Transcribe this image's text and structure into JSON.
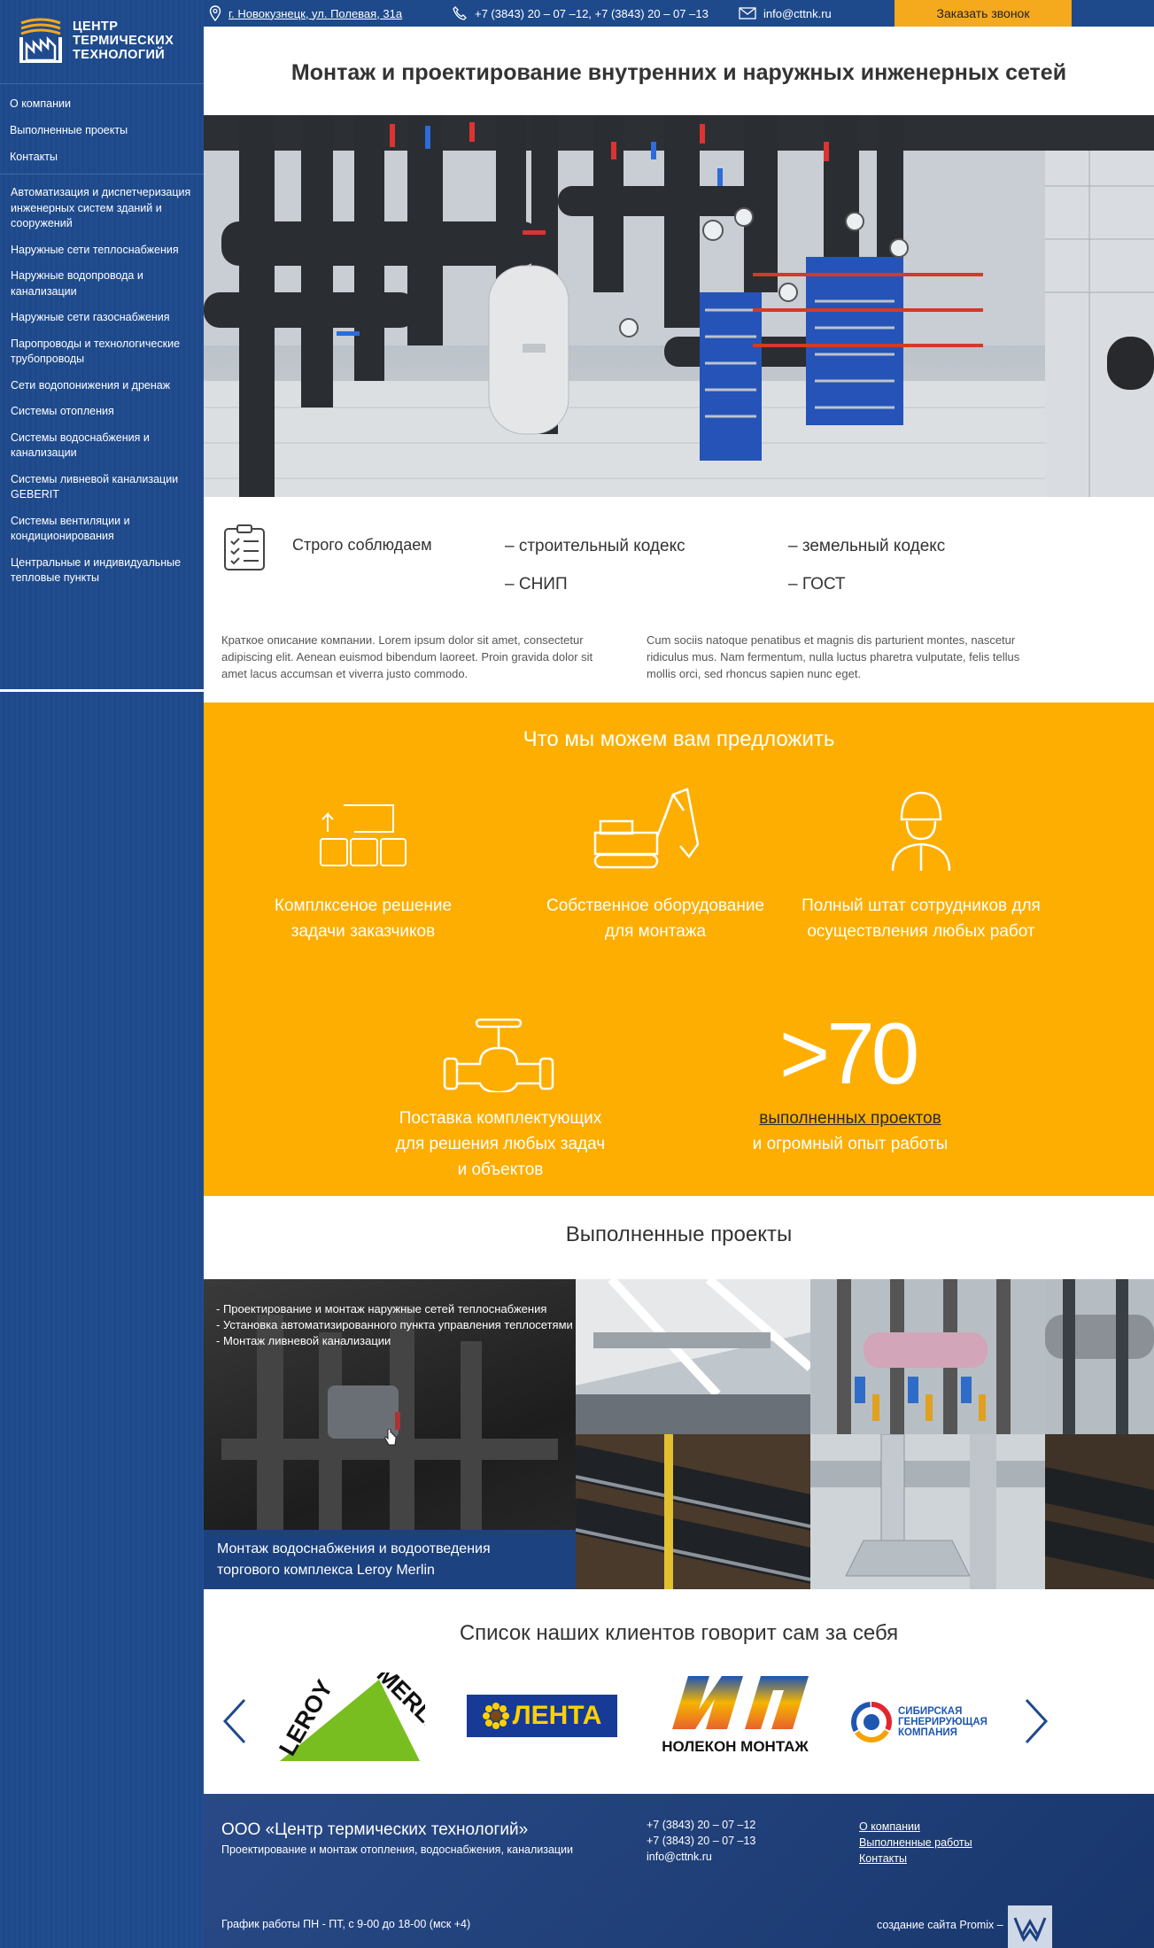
{
  "brand": {
    "name_line1": "Центр",
    "name_line2": "Термических",
    "name_line3": "Технологий"
  },
  "topbar": {
    "address": "г. Новокузнецк, ул. Полевая, 31а",
    "phones": "+7 (3843) 20 – 07 –12, +7 (3843) 20 – 07 –13",
    "email": "info@cttnk.ru",
    "callback_label": "Заказать звонок"
  },
  "nav_primary": [
    "О компании",
    "Выполненные проекты",
    "Контакты"
  ],
  "nav_services": [
    "Автоматизация и диспетчеризация инженерных систем зданий и сооружений",
    "Наружные сети теплоснабжения",
    "Наружные водопровода и канализации",
    "Наружные сети газоснабжения",
    "Паропроводы и технологические трубопроводы",
    "Сети водопонижения и дренаж",
    "Системы отопления",
    "Системы водоснабжения и канализации",
    "Системы ливневой канализации GEBERIT",
    "Системы вентиляции и кондиционирования",
    "Центральные и индивидуальные тепловые пункты"
  ],
  "page": {
    "title": "Монтаж и проектирование внутренних и наружных инженерных сетей"
  },
  "codes": {
    "label": "Строго соблюдаем",
    "items": [
      "– строительный кодекс",
      "– земельный кодекс",
      "– СНИП",
      "– ГОСТ"
    ],
    "text_left": "Краткое описание компании. Lorem ipsum dolor sit amet, consectetur adipiscing elit. Aenean euismod bibendum laoreet. Proin gravida dolor sit amet lacus accumsan et viverra justo commodo.",
    "text_right": "Cum sociis natoque penatibus et magnis dis parturient montes, nascetur ridiculus mus. Nam fermentum, nulla luctus pharetra vulputate, felis tellus mollis orci, sed rhoncus sapien nunc eget."
  },
  "offer": {
    "heading": "Что мы можем вам предложить",
    "f1": [
      "Комплксеное решение",
      "задачи заказчиков"
    ],
    "f2": [
      "Собственное оборудование",
      "для монтажа"
    ],
    "f3": [
      "Полный штат сотрудников для",
      "осуществления любых работ"
    ],
    "f4": [
      "Поставка комплектующих",
      "для решения любых задач",
      "и объектов"
    ],
    "big_number": ">70",
    "projects_link": "выполненных проектов",
    "experience": "и огромный опыт работы"
  },
  "projects": {
    "heading": "Выполненные проекты",
    "featured_list": [
      "- Проектирование и монтаж наружные сетей теплоснабжения",
      "- Установка автоматизированного пункта управления теплосетями",
      "- Монтаж ливневой канализации"
    ],
    "featured_caption": [
      "Монтаж водоснабжения и водоотведения",
      "торгового комплекса Leroy Merlin"
    ]
  },
  "clients": {
    "heading": "Список наших клиентов говорит сам за себя",
    "logos": [
      "LEROY MERLIN",
      "ЛЕНТА",
      "НОЛЕКОН МОНТАЖ",
      "СИБИРСКАЯ ГЕНЕРИРУЮЩАЯ КОМПАНИЯ"
    ],
    "leroy_top": "LEROY",
    "leroy_bottom": "MERLIN",
    "lenta": "ЛЕНТА",
    "nolekon": "НОЛЕКОН МОНТАЖ",
    "sgk": [
      "СИБИРСКАЯ",
      "ГЕНЕРИРУЮЩАЯ",
      "КОМПАНИЯ"
    ]
  },
  "footer": {
    "company": "ООО «Центр термических технологий»",
    "subtitle": "Проектирование и монтаж отопления, водоснабжения, канализации",
    "phone1": "+7 (3843) 20 – 07 –12",
    "phone2": "+7 (3843) 20 – 07 –13",
    "email": "info@cttnk.ru",
    "links": [
      "О компании",
      "Выполненные работы",
      "Контакты"
    ],
    "schedule": "График работы ПН - ПТ, с 9-00 до 18-00 (мск +4)",
    "credit": "создание сайта Promix –"
  },
  "colors": {
    "primary_blue": "#1e4a8c",
    "accent_orange": "#fdae00",
    "callback_orange": "#f5a91c"
  }
}
